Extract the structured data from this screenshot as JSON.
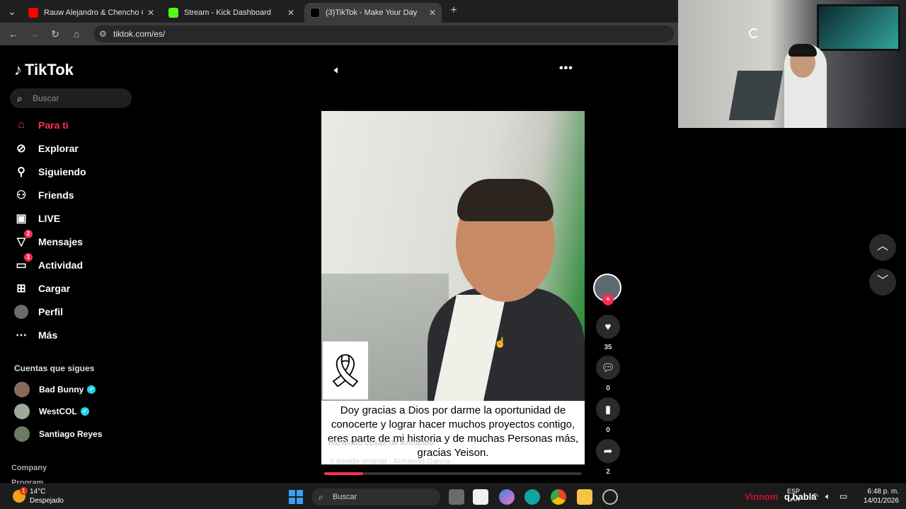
{
  "browser": {
    "tabs": [
      {
        "title": "Rauw Alejandro & Chencho Co",
        "favicon_color": "#ff0000",
        "active": false
      },
      {
        "title": "Stream - Kick Dashboard",
        "favicon_color": "#53fc18",
        "active": false
      },
      {
        "title": "(3)TikTok - Make Your Day",
        "favicon_color": "#000000",
        "active": true
      }
    ],
    "url": "tiktok.com/es/",
    "new_tab_icon": "plus-icon"
  },
  "sidebar": {
    "logo": "TikTok",
    "search_placeholder": "Buscar",
    "nav": [
      {
        "label": "Para ti",
        "icon": "home-icon",
        "active": true
      },
      {
        "label": "Explorar",
        "icon": "compass-icon"
      },
      {
        "label": "Siguiendo",
        "icon": "user-follow-icon"
      },
      {
        "label": "Friends",
        "icon": "friends-icon"
      },
      {
        "label": "LIVE",
        "icon": "live-icon"
      },
      {
        "label": "Mensajes",
        "icon": "message-icon",
        "badge": "2"
      },
      {
        "label": "Actividad",
        "icon": "activity-icon",
        "badge": "1"
      },
      {
        "label": "Cargar",
        "icon": "upload-icon"
      },
      {
        "label": "Perfil",
        "icon": "profile-avatar"
      },
      {
        "label": "Más",
        "icon": "more-icon"
      }
    ],
    "following_title": "Cuentas que sigues",
    "following": [
      {
        "name": "Bad Bunny",
        "verified": true
      },
      {
        "name": "WestCOL",
        "verified": true
      },
      {
        "name": "Santiago Reyes",
        "verified": false
      }
    ],
    "footer": [
      "Company",
      "Program"
    ]
  },
  "video": {
    "caption_text": "Doy gracias a Dios por darme la oportunidad de conocerte y lograr hacer muchos proyectos contigo, eres parte de mi historia y de muchas Personas más, gracias Yeison.",
    "overlay_author": "haciendo cosas de Armando",
    "sound": "sonido original - Armando García",
    "progress": 0.15,
    "actions": {
      "likes": "35",
      "comments": "0",
      "saves": "0",
      "shares": "2"
    }
  },
  "taskbar": {
    "weather_temp": "14°C",
    "weather_cond": "Despejado",
    "weather_badge": "1",
    "search_placeholder": "Buscar",
    "watermark_red": "Vinnom",
    "watermark_white": "q.habla",
    "lang_line1": "ESP",
    "lang_line2": "LAA",
    "time": "6:48 p. m.",
    "date": "14/01/2026"
  },
  "colors": {
    "accent": "#fe2c55",
    "verified": "#20d5ec"
  }
}
